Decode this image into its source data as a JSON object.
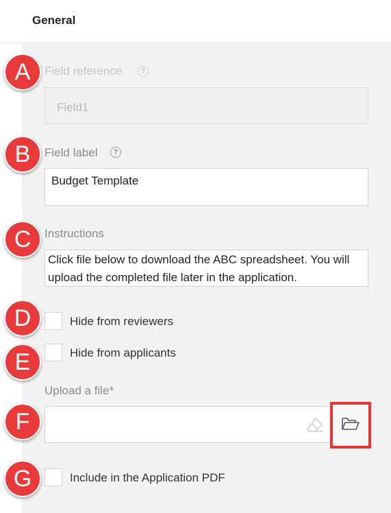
{
  "header": {
    "title": "General"
  },
  "markers": [
    "A",
    "B",
    "C",
    "D",
    "E",
    "F",
    "G"
  ],
  "field_reference": {
    "label": "Field reference",
    "value": "Field1"
  },
  "field_label": {
    "label": "Field label",
    "value": "Budget Template"
  },
  "instructions": {
    "label": "Instructions",
    "value": "Click file below to download the ABC spreadsheet. You will upload the completed file later in the application."
  },
  "hide_reviewers": {
    "label": "Hide from reviewers",
    "checked": false
  },
  "hide_applicants": {
    "label": "Hide from applicants",
    "checked": false
  },
  "upload": {
    "label": "Upload a file*",
    "value": ""
  },
  "include_pdf": {
    "label": "Include in the Application PDF",
    "checked": false
  },
  "icons": {
    "help": "help-circle-icon",
    "eraser": "eraser-icon",
    "folder": "folder-open-icon"
  }
}
